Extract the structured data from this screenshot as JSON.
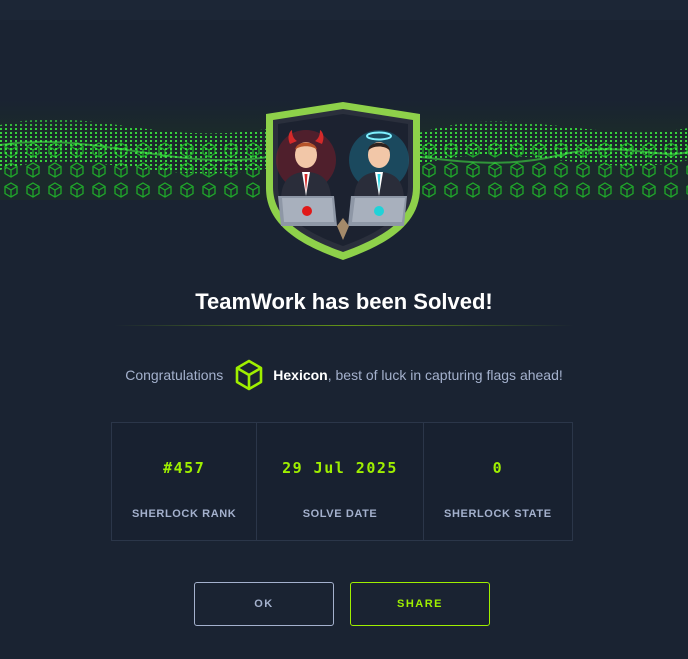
{
  "modal": {
    "title": "TeamWork has been Solved!",
    "congrats_prefix": "Congratulations",
    "username": "Hexicon",
    "congrats_suffix": ", best of luck in capturing flags ahead!",
    "avatar_icon": "cube-icon",
    "badge_icon": "teamwork-badge-icon"
  },
  "stats": [
    {
      "value": "#457",
      "label": "SHERLOCK RANK"
    },
    {
      "value": "29 Jul 2025",
      "label": "SOLVE DATE"
    },
    {
      "value": "0",
      "label": "SHERLOCK STATE"
    }
  ],
  "buttons": {
    "ok_label": "OK",
    "share_label": "SHARE"
  },
  "colors": {
    "background": "#1a2332",
    "accent": "#9fef00",
    "muted_text": "#a4b1cd",
    "title_text": "#ffffff"
  }
}
